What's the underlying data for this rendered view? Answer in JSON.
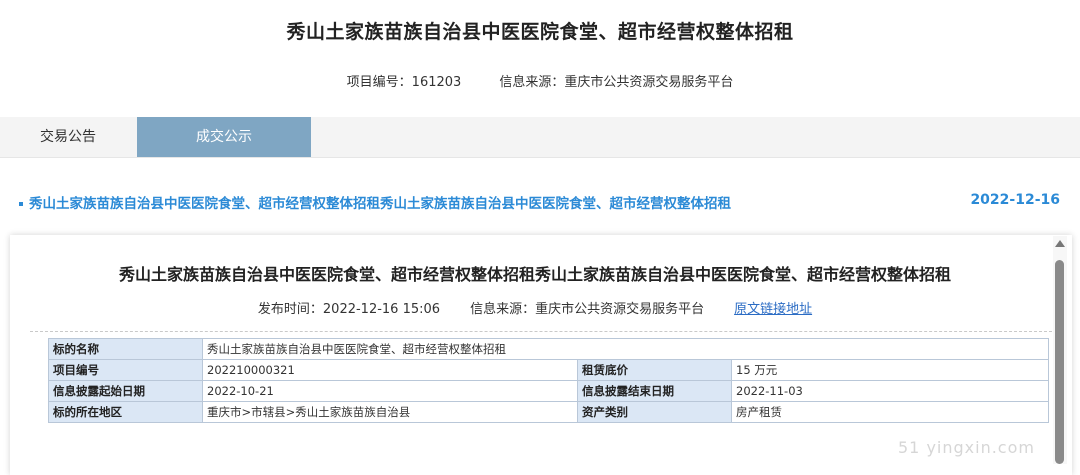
{
  "header": {
    "title": "秀山土家族苗族自治县中医医院食堂、超市经营权整体招租",
    "project_no": "项目编号：161203",
    "source": "信息来源：重庆市公共资源交易服务平台"
  },
  "tabs": [
    {
      "label": "交易公告",
      "active": false
    },
    {
      "label": "成交公示",
      "active": true
    }
  ],
  "list": [
    {
      "title": "秀山土家族苗族自治县中医医院食堂、超市经营权整体招租秀山土家族苗族自治县中医医院食堂、超市经营权整体招租",
      "date": "2022-12-16"
    }
  ],
  "detail": {
    "title": "秀山土家族苗族自治县中医医院食堂、超市经营权整体招租秀山土家族苗族自治县中医医院食堂、超市经营权整体招租",
    "publish_time": "发布时间：2022-12-16 15:06",
    "source": "信息来源：重庆市公共资源交易服务平台",
    "original_link": "原文链接地址",
    "table": {
      "name_label": "标的名称",
      "name_value": "秀山土家族苗族自治县中医医院食堂、超市经营权整体招租",
      "project_no_label": "项目编号",
      "project_no_value": "202210000321",
      "rent_floor_label": "租赁底价",
      "rent_floor_value": "15 万元",
      "start_label": "信息披露起始日期",
      "start_value": "2022-10-21",
      "end_label": "信息披露结束日期",
      "end_value": "2022-11-03",
      "region_label": "标的所在地区",
      "region_value": "重庆市>市辖县>秀山土家族苗族自治县",
      "asset_type_label": "资产类别",
      "asset_type_value": "房产租赁"
    }
  },
  "colors": {
    "accent": "#2b8ad6",
    "tab_active_bg": "#7fa6c3",
    "table_header_bg": "#dbe7f5"
  },
  "watermark": "51 yingxin.com"
}
